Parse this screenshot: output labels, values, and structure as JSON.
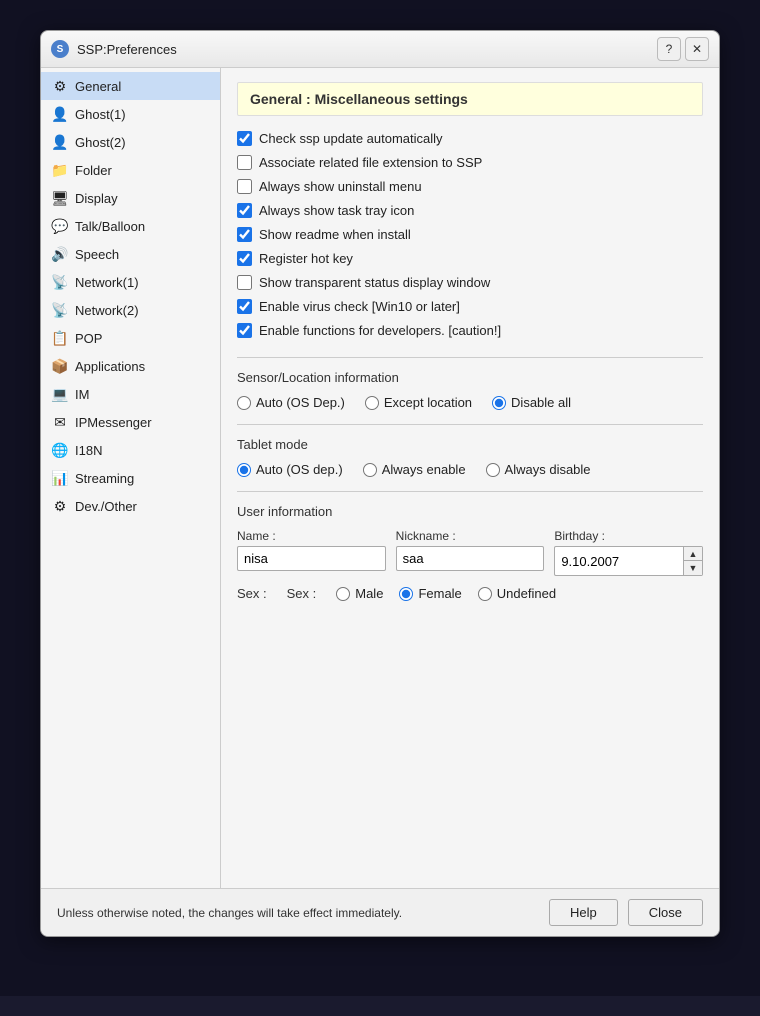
{
  "window": {
    "title": "SSP:Preferences",
    "icon": "S",
    "help_btn": "?",
    "close_btn": "✕"
  },
  "sidebar": {
    "items": [
      {
        "id": "general",
        "label": "General",
        "icon": "⚙",
        "selected": true
      },
      {
        "id": "ghost1",
        "label": "Ghost(1)",
        "icon": "👤"
      },
      {
        "id": "ghost2",
        "label": "Ghost(2)",
        "icon": "👤"
      },
      {
        "id": "folder",
        "label": "Folder",
        "icon": "📁"
      },
      {
        "id": "display",
        "label": "Display",
        "icon": "🖥"
      },
      {
        "id": "talkballoon",
        "label": "Talk/Balloon",
        "icon": "💬"
      },
      {
        "id": "speech",
        "label": "Speech",
        "icon": "🔊"
      },
      {
        "id": "network1",
        "label": "Network(1)",
        "icon": "📡"
      },
      {
        "id": "network2",
        "label": "Network(2)",
        "icon": "📡"
      },
      {
        "id": "pop",
        "label": "POP",
        "icon": "📋"
      },
      {
        "id": "applications",
        "label": "Applications",
        "icon": "📦"
      },
      {
        "id": "im",
        "label": "IM",
        "icon": "💻"
      },
      {
        "id": "ipmessenger",
        "label": "IPMessenger",
        "icon": "✉"
      },
      {
        "id": "i18n",
        "label": "I18N",
        "icon": "🌐"
      },
      {
        "id": "streaming",
        "label": "Streaming",
        "icon": "📊"
      },
      {
        "id": "devother",
        "label": "Dev./Other",
        "icon": "⚙"
      }
    ]
  },
  "main": {
    "section_title": "General : Miscellaneous settings",
    "checkboxes": [
      {
        "id": "check_ssp_update",
        "label": "Check ssp update automatically",
        "checked": true
      },
      {
        "id": "assoc_file_ext",
        "label": "Associate related file extension to SSP",
        "checked": false
      },
      {
        "id": "always_show_uninstall",
        "label": "Always show uninstall menu",
        "checked": false
      },
      {
        "id": "always_show_tray",
        "label": "Always show task tray icon",
        "checked": true
      },
      {
        "id": "show_readme",
        "label": "Show readme when install",
        "checked": true
      },
      {
        "id": "register_hotkey",
        "label": "Register hot key",
        "checked": true
      },
      {
        "id": "show_transparent",
        "label": "Show transparent status display window",
        "checked": false
      },
      {
        "id": "enable_virus",
        "label": "Enable virus check [Win10 or later]",
        "checked": true
      },
      {
        "id": "enable_dev",
        "label": "Enable functions for developers. [caution!]",
        "checked": true
      }
    ],
    "sensor_section": {
      "label": "Sensor/Location information",
      "options": [
        {
          "id": "sensor_auto",
          "label": "Auto (OS Dep.)",
          "checked": false
        },
        {
          "id": "sensor_except",
          "label": "Except location",
          "checked": false
        },
        {
          "id": "sensor_disable",
          "label": "Disable all",
          "checked": true
        }
      ]
    },
    "tablet_section": {
      "label": "Tablet mode",
      "options": [
        {
          "id": "tablet_auto",
          "label": "Auto (OS dep.)",
          "checked": true
        },
        {
          "id": "tablet_enable",
          "label": "Always enable",
          "checked": false
        },
        {
          "id": "tablet_disable",
          "label": "Always disable",
          "checked": false
        }
      ]
    },
    "user_section": {
      "label": "User information",
      "name_label": "Name :",
      "name_value": "nisa",
      "nickname_label": "Nickname :",
      "nickname_value": "saa",
      "birthday_label": "Birthday :",
      "birthday_value": "9.10.2007",
      "sex_label": "Sex :",
      "sex_options": [
        {
          "id": "sex_male",
          "label": "Male",
          "checked": false
        },
        {
          "id": "sex_female",
          "label": "Female",
          "checked": true
        },
        {
          "id": "sex_undefined",
          "label": "Undefined",
          "checked": false
        }
      ]
    }
  },
  "footer": {
    "note": "Unless otherwise noted, the changes will take effect immediately.",
    "help_btn": "Help",
    "close_btn": "Close"
  }
}
